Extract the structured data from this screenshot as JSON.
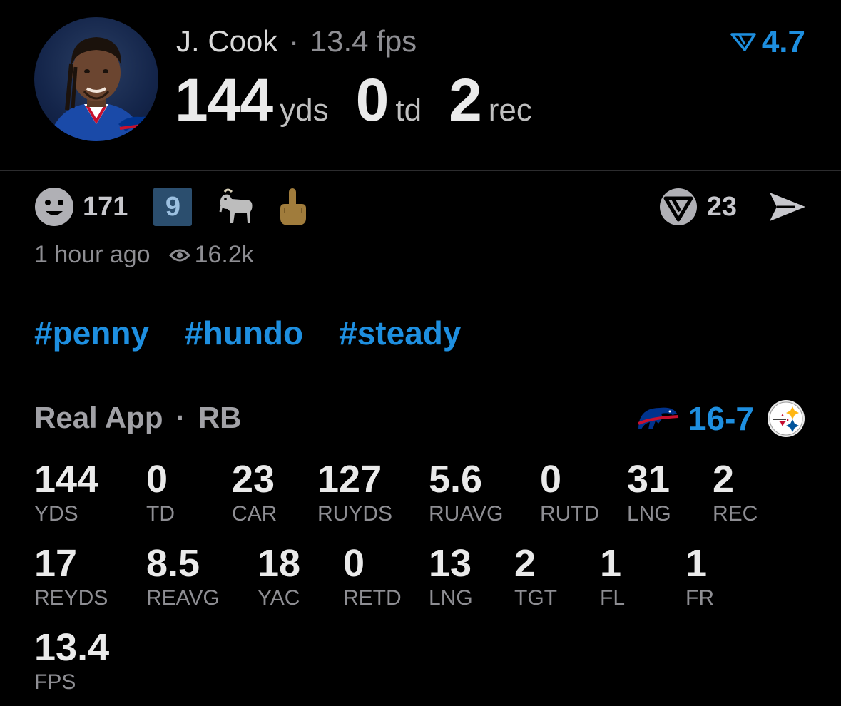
{
  "player": {
    "name": "J. Cook",
    "separator": "·",
    "fps_label": "13.4 fps",
    "yds": "144",
    "yds_unit": "yds",
    "td": "0",
    "td_unit": "td",
    "rec": "2",
    "rec_unit": "rec"
  },
  "rating": {
    "value": "4.7",
    "icon": "rating-filter-icon",
    "color": "#1e8fe0"
  },
  "reactions": {
    "smile_count": "171",
    "nine_badge": "9",
    "share_count": "23"
  },
  "meta": {
    "time": "1 hour ago",
    "views": "16.2k"
  },
  "tags": [
    "#penny",
    "#hundo",
    "#steady"
  ],
  "league": {
    "name": "Real App",
    "separator": "·",
    "position": "RB"
  },
  "game": {
    "home_score": "16",
    "dash": "-",
    "away_score": "7",
    "score_color": "#1e8fe0"
  },
  "stats": [
    [
      {
        "val": "144",
        "lbl": "YDS"
      },
      {
        "val": "0",
        "lbl": "TD"
      },
      {
        "val": "23",
        "lbl": "CAR"
      },
      {
        "val": "127",
        "lbl": "RUYDS"
      },
      {
        "val": "5.6",
        "lbl": "RUAVG"
      },
      {
        "val": "0",
        "lbl": "RUTD"
      },
      {
        "val": "31",
        "lbl": "LNG"
      },
      {
        "val": "2",
        "lbl": "REC"
      }
    ],
    [
      {
        "val": "17",
        "lbl": "REYDS"
      },
      {
        "val": "8.5",
        "lbl": "REAVG"
      },
      {
        "val": "18",
        "lbl": "YAC"
      },
      {
        "val": "0",
        "lbl": "RETD"
      },
      {
        "val": "13",
        "lbl": "LNG"
      },
      {
        "val": "2",
        "lbl": "TGT"
      },
      {
        "val": "1",
        "lbl": "FL"
      },
      {
        "val": "1",
        "lbl": "FR"
      }
    ],
    [
      {
        "val": "13.4",
        "lbl": "FPS"
      }
    ]
  ]
}
